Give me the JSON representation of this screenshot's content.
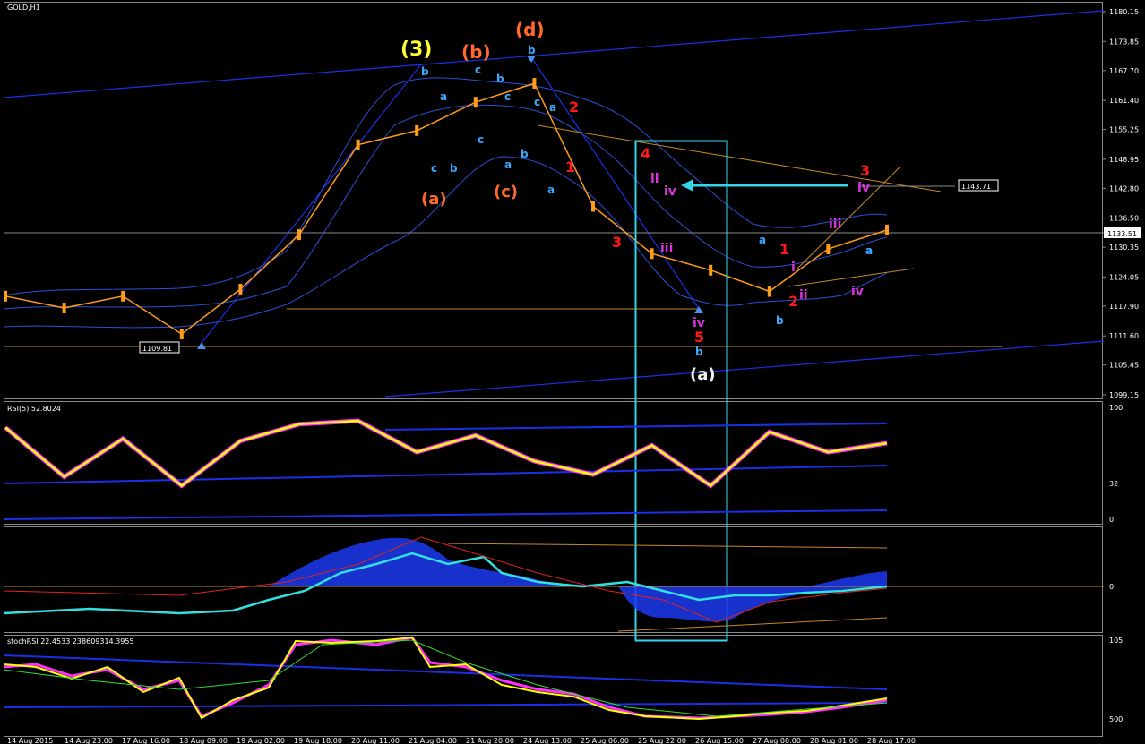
{
  "window_title": "GOLD,H1",
  "panels": {
    "rsi_title": "RSI(5) 52.8024",
    "stoch_title": "stochRSI 22.4533 238609314.3955"
  },
  "price_axis": {
    "ticks": [
      "1180.15",
      "1173.85",
      "1167.70",
      "1161.40",
      "1155.25",
      "1148.95",
      "1142.80",
      "1136.50",
      "1130.35",
      "1124.05",
      "1117.90",
      "1111.60",
      "1105.45",
      "1099.15"
    ],
    "current_price": "1133.51",
    "marked_level": "1143.71",
    "low_label": "1109.81"
  },
  "rsi_axis": {
    "ticks": [
      "100",
      "32",
      "0"
    ]
  },
  "macd_axis": {
    "ticks": [
      "0"
    ]
  },
  "stoch_axis": {
    "ticks": [
      "105",
      "500"
    ]
  },
  "time_axis": {
    "ticks": [
      "14 Aug 2015",
      "14 Aug 23:00",
      "17 Aug 16:00",
      "18 Aug 09:00",
      "19 Aug 02:00",
      "19 Aug 18:00",
      "20 Aug 11:00",
      "21 Aug 04:00",
      "21 Aug 20:00",
      "24 Aug 13:00",
      "25 Aug 06:00",
      "25 Aug 22:00",
      "26 Aug 15:00",
      "27 Aug 08:00",
      "28 Aug 01:00",
      "28 Aug 17:00"
    ]
  },
  "wave_labels": [
    {
      "text": "(3)",
      "color": "#ffff33"
    },
    {
      "text": "(b)",
      "color": "#ff6a2b"
    },
    {
      "text": "(d)",
      "color": "#ff6a2b"
    },
    {
      "text": "(a)",
      "color": "#ff6a2b"
    },
    {
      "text": "(c)",
      "color": "#ff6a2b"
    },
    {
      "text": "(a)",
      "color": "#f0f0f0"
    },
    {
      "text": "b",
      "color": "#3aa8ff"
    },
    {
      "text": "a",
      "color": "#3aa8ff"
    },
    {
      "text": "c",
      "color": "#3aa8ff"
    },
    {
      "text": "b",
      "color": "#3aa8ff"
    },
    {
      "text": "c",
      "color": "#3aa8ff"
    },
    {
      "text": "b",
      "color": "#3aa8ff"
    },
    {
      "text": "a",
      "color": "#3aa8ff"
    },
    {
      "text": "a",
      "color": "#3aa8ff"
    },
    {
      "text": "c",
      "color": "#3aa8ff"
    },
    {
      "text": "b",
      "color": "#3aa8ff"
    },
    {
      "text": "c",
      "color": "#3aa8ff"
    },
    {
      "text": "b",
      "color": "#3aa8ff"
    },
    {
      "text": "a",
      "color": "#3aa8ff"
    },
    {
      "text": "c",
      "color": "#3aa8ff"
    },
    {
      "text": "a",
      "color": "#3aa8ff"
    },
    {
      "text": "b",
      "color": "#3aa8ff"
    },
    {
      "text": "a",
      "color": "#3aa8ff"
    },
    {
      "text": "2",
      "color": "#ff1a1a"
    },
    {
      "text": "1",
      "color": "#ff1a1a"
    },
    {
      "text": "3",
      "color": "#ff1a1a"
    },
    {
      "text": "4",
      "color": "#ff1a1a"
    },
    {
      "text": "5",
      "color": "#ff1a1a"
    },
    {
      "text": "1",
      "color": "#ff1a1a"
    },
    {
      "text": "2",
      "color": "#ff1a1a"
    },
    {
      "text": "3",
      "color": "#ff1a1a"
    },
    {
      "text": "ii",
      "color": "#dd33dd"
    },
    {
      "text": "iv",
      "color": "#dd33dd"
    },
    {
      "text": "iii",
      "color": "#dd33dd"
    },
    {
      "text": "iv",
      "color": "#dd33dd"
    },
    {
      "text": "i",
      "color": "#dd33dd"
    },
    {
      "text": "ii",
      "color": "#dd33dd"
    },
    {
      "text": "iii",
      "color": "#dd33dd"
    },
    {
      "text": "iv",
      "color": "#dd33dd"
    },
    {
      "text": "iv",
      "color": "#dd33dd"
    },
    {
      "text": "b",
      "color": "#3aa8ff"
    },
    {
      "text": "a",
      "color": "#3aa8ff"
    }
  ],
  "chart_data": {
    "type": "line",
    "title": "GOLD,H1",
    "ylim": [
      1099.15,
      1180.15
    ],
    "x": [
      "14 Aug 2015",
      "14 Aug 23:00",
      "17 Aug 16:00",
      "18 Aug 09:00",
      "19 Aug 02:00",
      "19 Aug 18:00",
      "20 Aug 11:00",
      "21 Aug 04:00",
      "21 Aug 20:00",
      "24 Aug 13:00",
      "25 Aug 06:00",
      "25 Aug 22:00",
      "26 Aug 15:00",
      "27 Aug 08:00",
      "28 Aug 01:00",
      "28 Aug 17:00"
    ],
    "series": [
      {
        "values": [
          1120.0,
          1117.5,
          1120.0,
          1112.0,
          1121.5,
          1133.0,
          1152.0,
          1155.0,
          1161.0,
          1165.0,
          1139.0,
          1129.0,
          1125.5,
          1121.0,
          1130.0,
          1134.0
        ]
      }
    ],
    "rsi": {
      "ylim": [
        0,
        100
      ],
      "levels": [
        32
      ],
      "values": [
        82,
        38,
        72,
        30,
        70,
        85,
        88,
        60,
        75,
        52,
        40,
        66,
        30,
        78,
        60,
        68
      ]
    },
    "colors": {
      "background": "#000000",
      "candle": "#ff9c1a",
      "bands": "#2a50d8",
      "channel": "#1b2fe6",
      "box": "#33d6e8",
      "rsi_line": "#ffff00",
      "rsi_glow": "#ff30ff"
    },
    "grid": false
  }
}
